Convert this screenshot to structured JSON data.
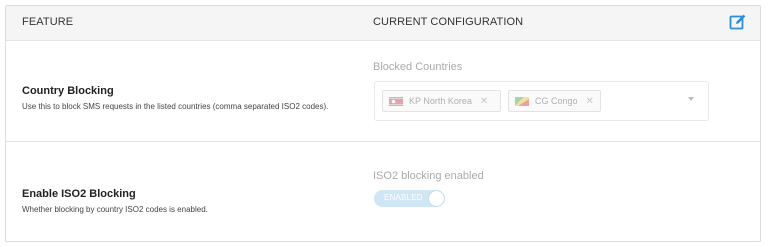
{
  "header": {
    "feature_col": "FEATURE",
    "config_col": "CURRENT CONFIGURATION",
    "edit_icon": "edit-icon"
  },
  "rows": [
    {
      "name": "Country Blocking",
      "description": "Use this to block SMS requests in the listed countries (comma separated ISO2 codes).",
      "field_label": "Blocked Countries",
      "tags": [
        {
          "label": "KP North Korea",
          "flag_icon": "north-korea-flag-icon"
        },
        {
          "label": "CG Congo",
          "flag_icon": "congo-flag-icon"
        }
      ]
    },
    {
      "name": "Enable ISO2 Blocking",
      "description": "Whether blocking by country ISO2 codes is enabled.",
      "field_label": "ISO2 blocking enabled",
      "toggle_label": "ENABLED",
      "toggle_on": true
    }
  ],
  "colors": {
    "accent": "#2a8fd4",
    "toggle_bg": "#cfe6f5",
    "header_bg": "#f5f5f5",
    "muted_text": "#aaaaaa"
  }
}
